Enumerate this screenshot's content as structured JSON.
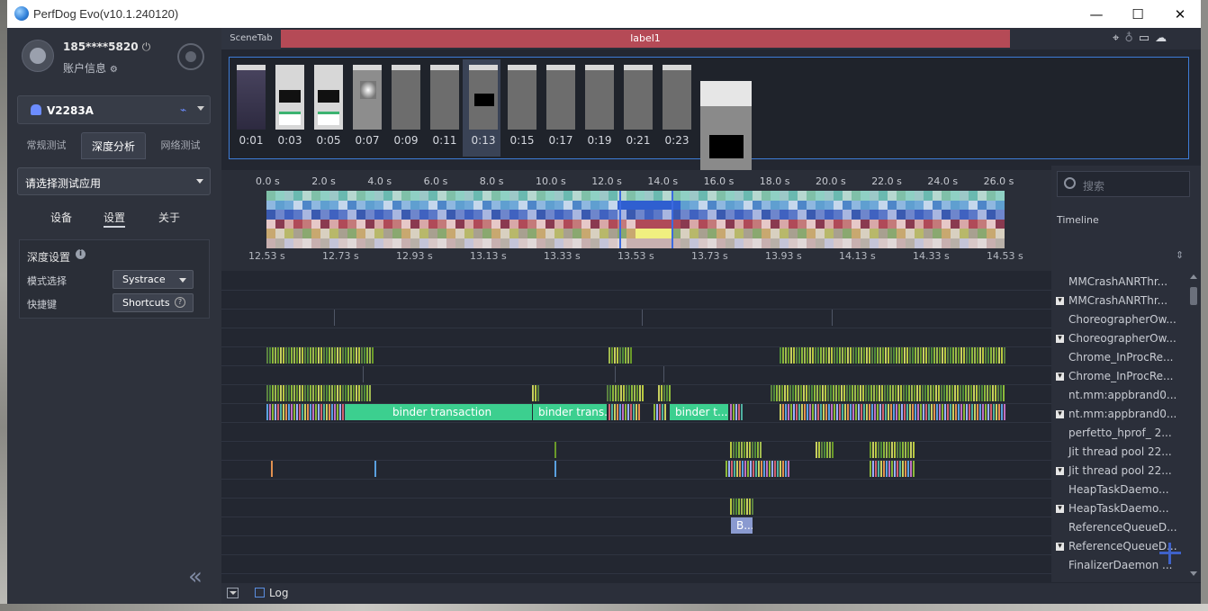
{
  "window": {
    "title": "PerfDog Evo(v10.1.240120)",
    "minimize": "—",
    "maximize": "☐",
    "close": "✕"
  },
  "user": {
    "name": "185****5820",
    "account_label": "账户信息"
  },
  "device": {
    "name": "V2283A"
  },
  "left_tabs": [
    "常规测试",
    "深度分析",
    "网络测试"
  ],
  "app_select": {
    "placeholder": "请选择测试应用"
  },
  "sub_tabs": [
    "设备",
    "设置",
    "关于"
  ],
  "settings": {
    "title": "深度设置",
    "mode_label": "模式选择",
    "mode_value": "Systrace",
    "shortcut_label": "快捷键",
    "shortcut_value": "Shortcuts"
  },
  "scene": {
    "tab": "SceneTab",
    "label": "label1"
  },
  "thumbnails": [
    "0:01",
    "0:03",
    "0:05",
    "0:07",
    "0:09",
    "0:11",
    "0:13",
    "0:15",
    "0:17",
    "0:19",
    "0:21",
    "0:23"
  ],
  "top_ticks": [
    "0.0 s",
    "2.0 s",
    "4.0 s",
    "6.0 s",
    "8.0 s",
    "10.0 s",
    "12.0 s",
    "14.0 s",
    "16.0 s",
    "18.0 s",
    "20.0 s",
    "22.0 s",
    "24.0 s",
    "26.0 s"
  ],
  "bottom_ticks": [
    "12.53 s",
    "12.73 s",
    "12.93 s",
    "13.13 s",
    "13.33 s",
    "13.53 s",
    "13.73 s",
    "13.93 s",
    "14.13 s",
    "14.33 s",
    "14.53 s"
  ],
  "search": {
    "placeholder": "搜索"
  },
  "timeline_label": "Timeline",
  "thread_names": [
    {
      "name": "MMCrashANRThr...",
      "expand": false
    },
    {
      "name": "MMCrashANRThr...",
      "expand": true
    },
    {
      "name": "ChoreographerOw...",
      "expand": false
    },
    {
      "name": "ChoreographerOw...",
      "expand": true
    },
    {
      "name": "Chrome_InProcRe...",
      "expand": false
    },
    {
      "name": "Chrome_InProcRe...",
      "expand": true
    },
    {
      "name": "nt.mm:appbrand0...",
      "expand": false
    },
    {
      "name": "nt.mm:appbrand0...",
      "expand": true
    },
    {
      "name": "perfetto_hprof_ 2...",
      "expand": false
    },
    {
      "name": "Jit thread pool 22...",
      "expand": false
    },
    {
      "name": "Jit thread pool 22...",
      "expand": true
    },
    {
      "name": "HeapTaskDaemo...",
      "expand": false
    },
    {
      "name": "HeapTaskDaemo...",
      "expand": true
    },
    {
      "name": "ReferenceQueueD...",
      "expand": false
    },
    {
      "name": "ReferenceQueueD...",
      "expand": true
    },
    {
      "name": "FinalizerDaemon ...",
      "expand": false
    }
  ],
  "slices": {
    "binder1": "binder transaction",
    "binder2": "binder trans...",
    "binder3": "binder t...",
    "b": "B..."
  },
  "bottom": {
    "log_label": "Log"
  },
  "colors": {
    "accent": "#3d7cd6",
    "label_bar": "#b54a56",
    "binder": "#3ccf8f",
    "bg": "#232731"
  }
}
